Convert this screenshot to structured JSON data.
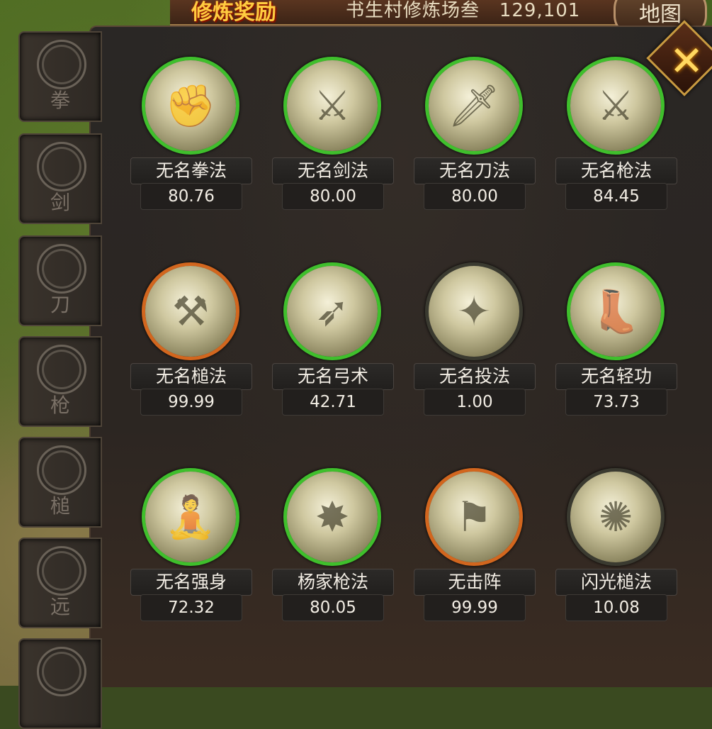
{
  "header": {
    "reward_banner": "修炼奖励",
    "title": "书生村修炼场叁",
    "score": "129,101",
    "map_button": "地图"
  },
  "close_label": "✕",
  "categories": [
    {
      "label": "拳",
      "icon": "fist-icon"
    },
    {
      "label": "剑",
      "icon": "sword-icon"
    },
    {
      "label": "刀",
      "icon": "blade-icon"
    },
    {
      "label": "枪",
      "icon": "spear-icon"
    },
    {
      "label": "槌",
      "icon": "axe-icon"
    },
    {
      "label": "远",
      "icon": "bow-icon"
    },
    {
      "label": "",
      "icon": "shuriken-icon"
    }
  ],
  "skills": [
    {
      "name": "无名拳法",
      "value": "80.76",
      "ring": "green",
      "icon": "fist-icon",
      "glyph": "✊"
    },
    {
      "name": "无名剑法",
      "value": "80.00",
      "ring": "green",
      "icon": "sword-icon",
      "glyph": "⚔"
    },
    {
      "name": "无名刀法",
      "value": "80.00",
      "ring": "green",
      "icon": "blade-icon",
      "glyph": "🗡"
    },
    {
      "name": "无名枪法",
      "value": "84.45",
      "ring": "green",
      "icon": "spear-icon",
      "glyph": "⚔"
    },
    {
      "name": "无名槌法",
      "value": "99.99",
      "ring": "orange",
      "icon": "axe-icon",
      "glyph": "⚒"
    },
    {
      "name": "无名弓术",
      "value": "42.71",
      "ring": "green",
      "icon": "arrow-icon",
      "glyph": "➶"
    },
    {
      "name": "无名投法",
      "value": "1.00",
      "ring": "none",
      "icon": "shuriken-icon",
      "glyph": "✦"
    },
    {
      "name": "无名轻功",
      "value": "73.73",
      "ring": "green",
      "icon": "boot-icon",
      "glyph": "👢"
    },
    {
      "name": "无名强身",
      "value": "72.32",
      "ring": "green",
      "icon": "body-icon",
      "glyph": "🧘"
    },
    {
      "name": "杨家枪法",
      "value": "80.05",
      "ring": "green",
      "icon": "spear-burst-icon",
      "glyph": "✸"
    },
    {
      "name": "无击阵",
      "value": "99.99",
      "ring": "orange",
      "icon": "formation-icon",
      "glyph": "⚑"
    },
    {
      "name": "闪光槌法",
      "value": "10.08",
      "ring": "none",
      "icon": "flash-axe-icon",
      "glyph": "✺"
    }
  ],
  "colors": {
    "ring_green": "#3fbf2c",
    "ring_orange": "#d2661e",
    "panel": "#2a2725"
  }
}
